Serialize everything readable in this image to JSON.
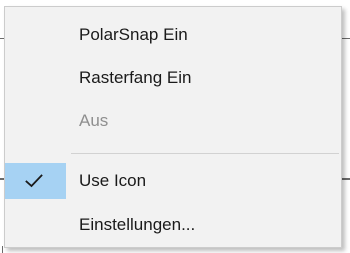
{
  "context_menu": {
    "items": [
      {
        "label": "PolarSnap Ein",
        "enabled": true,
        "checked": false
      },
      {
        "label": "Rasterfang Ein",
        "enabled": true,
        "checked": false
      },
      {
        "label": "Aus",
        "enabled": false,
        "checked": false
      },
      {
        "label": "Use Icon",
        "enabled": true,
        "checked": true
      },
      {
        "label": "Einstellungen...",
        "enabled": true,
        "checked": false
      }
    ],
    "icons": {
      "check": "check-icon"
    },
    "colors": {
      "menu_background": "#f2f2f2",
      "checked_highlight": "#a6d2f3",
      "disabled_text": "#8f8f8f",
      "text": "#1a1a1a"
    }
  }
}
